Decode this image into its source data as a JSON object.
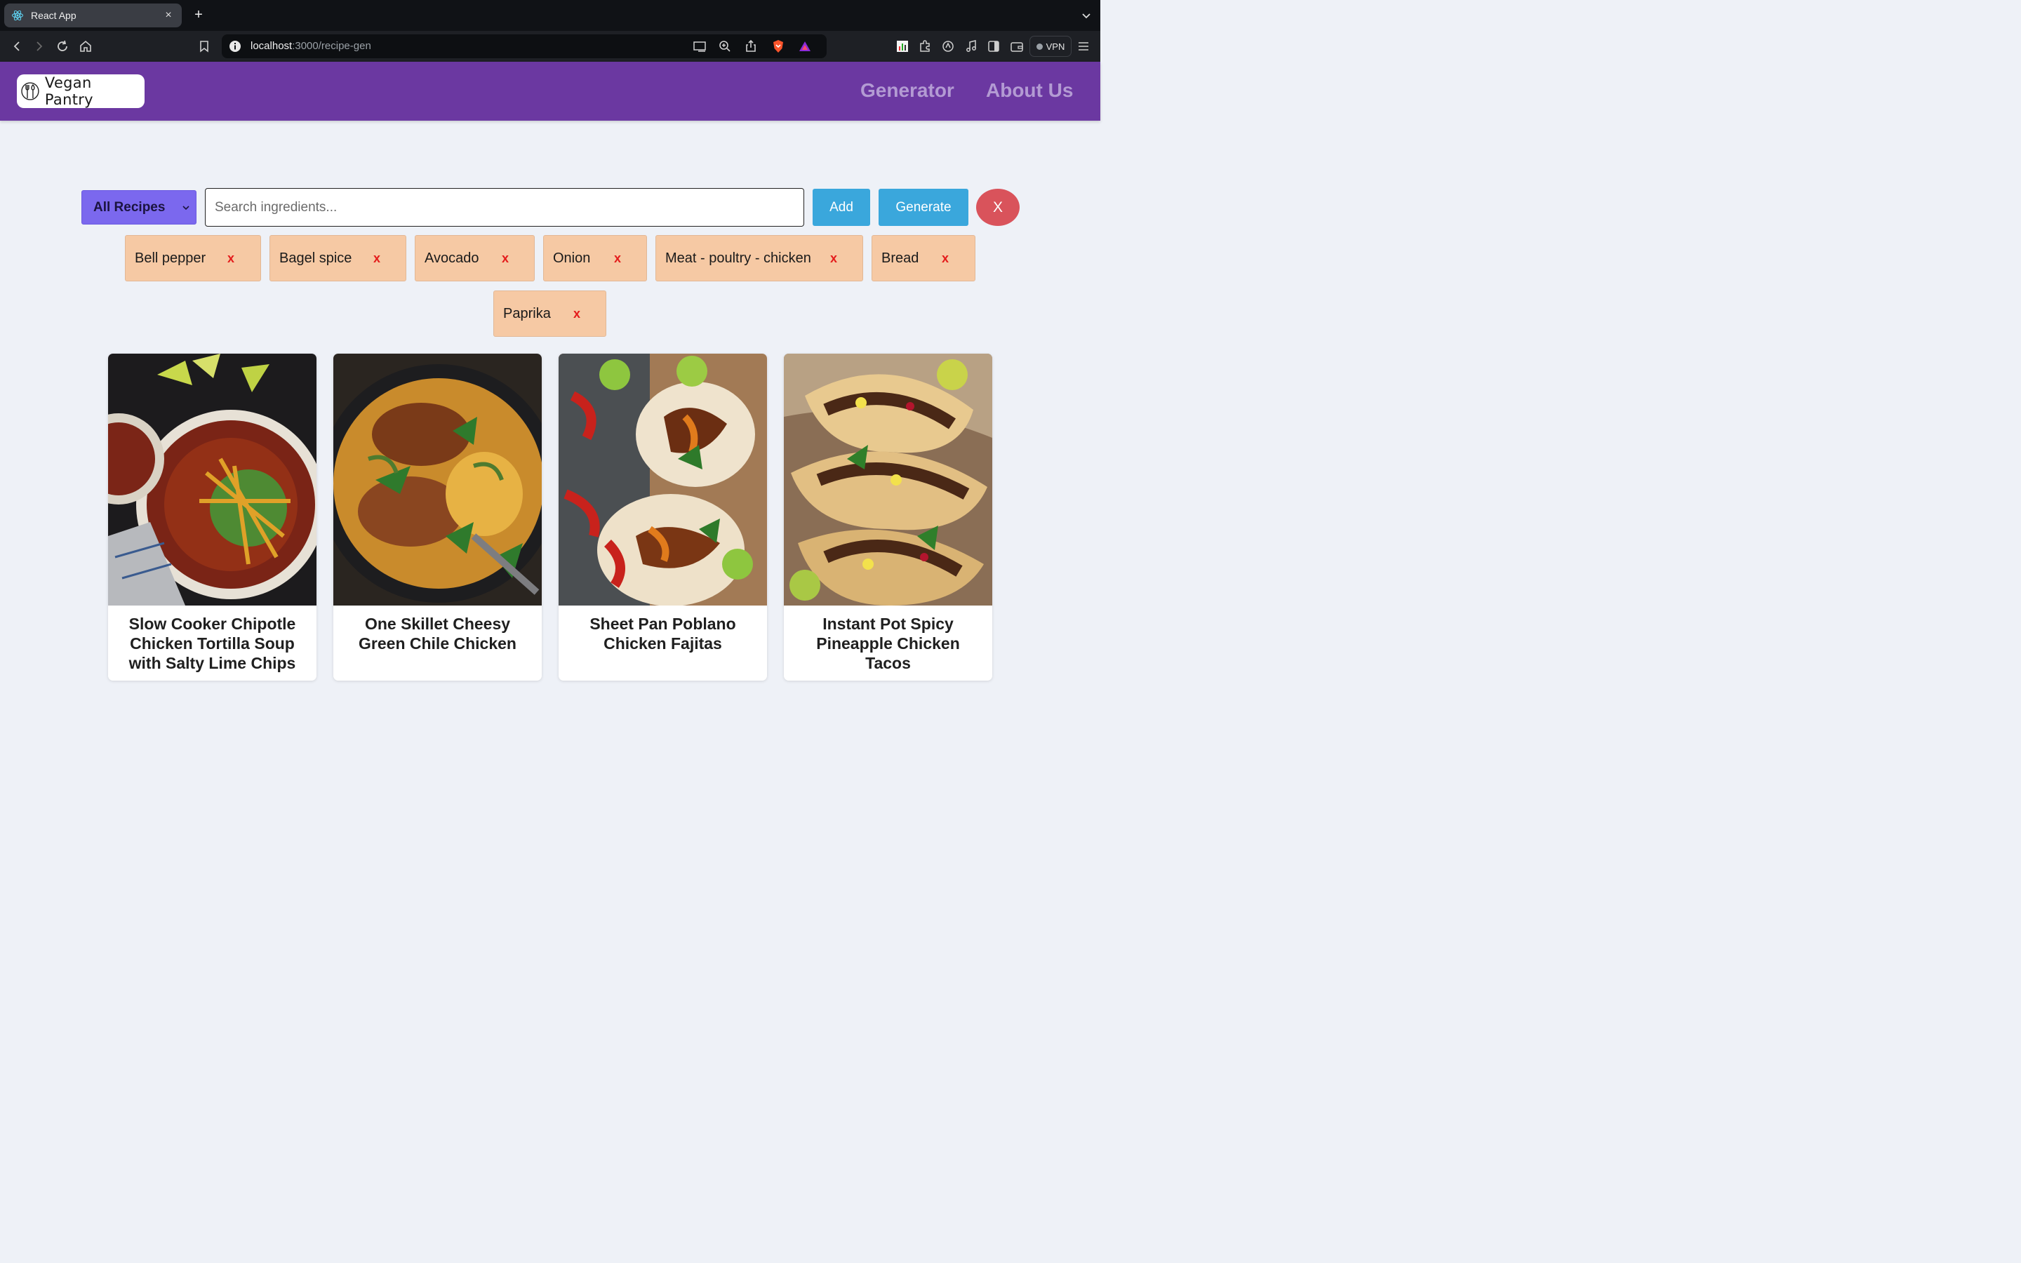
{
  "browser": {
    "tab_title": "React App",
    "tab_close": "×",
    "new_tab": "+",
    "url_host": "localhost",
    "url_path": ":3000/recipe-gen",
    "vpn_label": "VPN"
  },
  "header": {
    "logo_text": "Vegan Pantry",
    "nav": [
      "Generator",
      "About Us"
    ],
    "brand_color": "#6b38a1"
  },
  "search": {
    "filter_selected": "All Recipes",
    "placeholder": "Search ingredients...",
    "value": "",
    "add_label": "Add",
    "generate_label": "Generate",
    "clear_label": "X"
  },
  "ingredients": [
    {
      "name": "Bell pepper",
      "remove": "x"
    },
    {
      "name": "Bagel spice",
      "remove": "x"
    },
    {
      "name": "Avocado",
      "remove": "x"
    },
    {
      "name": "Onion",
      "remove": "x"
    },
    {
      "name": "Meat - poultry - chicken",
      "remove": "x"
    },
    {
      "name": "Bread",
      "remove": "x"
    },
    {
      "name": "Paprika",
      "remove": "x"
    }
  ],
  "recipes": [
    {
      "title": "Slow Cooker Chipotle Chicken Tortilla Soup with Salty Lime Chips"
    },
    {
      "title": "One Skillet Cheesy Green Chile Chicken"
    },
    {
      "title": "Sheet Pan Poblano Chicken Fajitas"
    },
    {
      "title": "Instant Pot Spicy Pineapple Chicken Tacos"
    }
  ]
}
